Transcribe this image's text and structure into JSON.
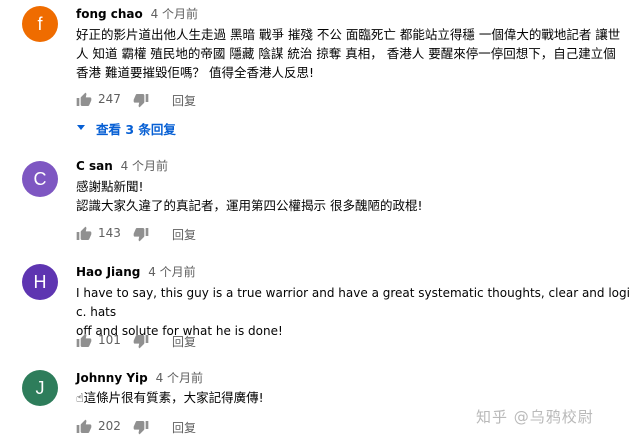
{
  "comments": [
    {
      "avatar_letter": "f",
      "avatar_color": "#ef6c00",
      "author": "fong chao",
      "time": "4 个月前",
      "lines": [
        "好正的影片道出他人生走過 黑暗 戰爭 摧殘 不公 面臨死亡 都能站立得穩 一個偉大的戰地記者 讓世",
        "人 知道 霸權 殖民地的帝國 隱藏 陰謀 統治 掠奪 真相， 香港人 要醒來停一停回想下，自己建立個",
        "香港 難道要摧毀佢嗎？ 值得全香港人反思!"
      ],
      "likes": "247",
      "reply_label": "回复",
      "view_replies": "查看 3 条回复"
    },
    {
      "avatar_letter": "C",
      "avatar_color": "#7e57c2",
      "author": "C san",
      "time": "4 个月前",
      "lines": [
        "感謝點新聞!",
        "認識大家久違了的真記者，運用第四公權揭示 很多醜陋的政棍!"
      ],
      "likes": "143",
      "reply_label": "回复"
    },
    {
      "avatar_letter": "H",
      "avatar_color": "#5e35b1",
      "author": "Hao Jiang",
      "time": "4 个月前",
      "lines": [
        "I have to say, this guy is a true warrior and have a great systematic thoughts, clear and logic. hats",
        "off and solute for what he is done!"
      ],
      "likes": "101",
      "reply_label": "回复"
    },
    {
      "avatar_letter": "J",
      "avatar_color": "#2e7d5b",
      "author": "Johnny Yip",
      "time": "4 个月前",
      "lines": [
        "☝這條片很有質素，大家記得廣傳!"
      ],
      "likes": "202",
      "reply_label": "回复"
    }
  ],
  "watermark": "知乎 @乌鸦校尉"
}
